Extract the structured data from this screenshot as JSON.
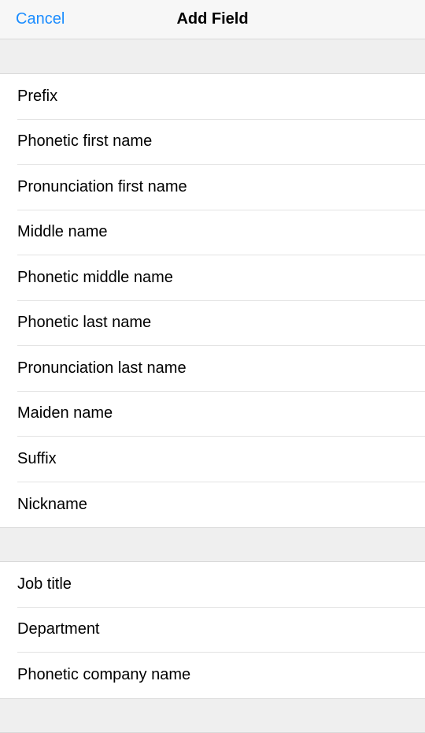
{
  "navbar": {
    "cancel_label": "Cancel",
    "title": "Add Field"
  },
  "sections": {
    "names": {
      "items": [
        {
          "label": "Prefix"
        },
        {
          "label": "Phonetic first name"
        },
        {
          "label": "Pronunciation first name"
        },
        {
          "label": "Middle name"
        },
        {
          "label": "Phonetic middle name"
        },
        {
          "label": "Phonetic last name"
        },
        {
          "label": "Pronunciation last name"
        },
        {
          "label": "Maiden name"
        },
        {
          "label": "Suffix"
        },
        {
          "label": "Nickname"
        }
      ]
    },
    "work": {
      "items": [
        {
          "label": "Job title"
        },
        {
          "label": "Department"
        },
        {
          "label": "Phonetic company name"
        }
      ]
    }
  }
}
